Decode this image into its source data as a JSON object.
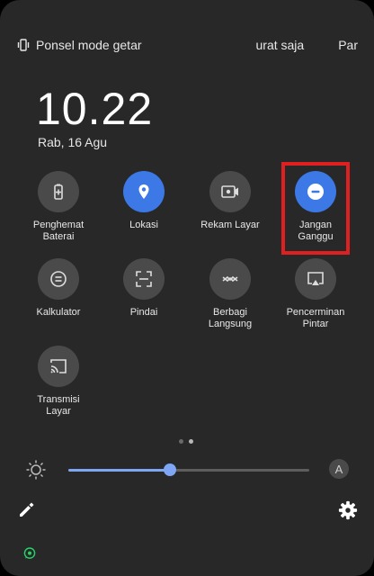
{
  "status": {
    "mode_text": "Ponsel mode getar",
    "middle_text": "urat saja",
    "right_text": "Par"
  },
  "clock": {
    "time": "10.22",
    "date": "Rab, 16 Agu"
  },
  "tiles": [
    {
      "label": "Penghemat\nBaterai",
      "icon": "battery-saver-icon",
      "active": false
    },
    {
      "label": "Lokasi",
      "icon": "location-icon",
      "active": true
    },
    {
      "label": "Rekam Layar",
      "icon": "screen-record-icon",
      "active": false
    },
    {
      "label": "Jangan\nGanggu",
      "icon": "do-not-disturb-icon",
      "active": true
    },
    {
      "label": "Kalkulator",
      "icon": "calculator-icon",
      "active": false
    },
    {
      "label": "Pindai",
      "icon": "scan-icon",
      "active": false
    },
    {
      "label": "Berbagi\nLangsung",
      "icon": "share-icon",
      "active": false
    },
    {
      "label": "Pencerminan\nPintar",
      "icon": "screen-mirror-icon",
      "active": false
    },
    {
      "label": "Transmisi\nLayar",
      "icon": "cast-icon",
      "active": false
    }
  ],
  "pager": {
    "pages": 2,
    "current": 2
  },
  "brightness": {
    "level": 0.42,
    "auto_label": "A"
  },
  "colors": {
    "panel": "#282828",
    "accent": "#3c78e6",
    "tile": "#4a4a4a",
    "highlight": "#e02020"
  }
}
